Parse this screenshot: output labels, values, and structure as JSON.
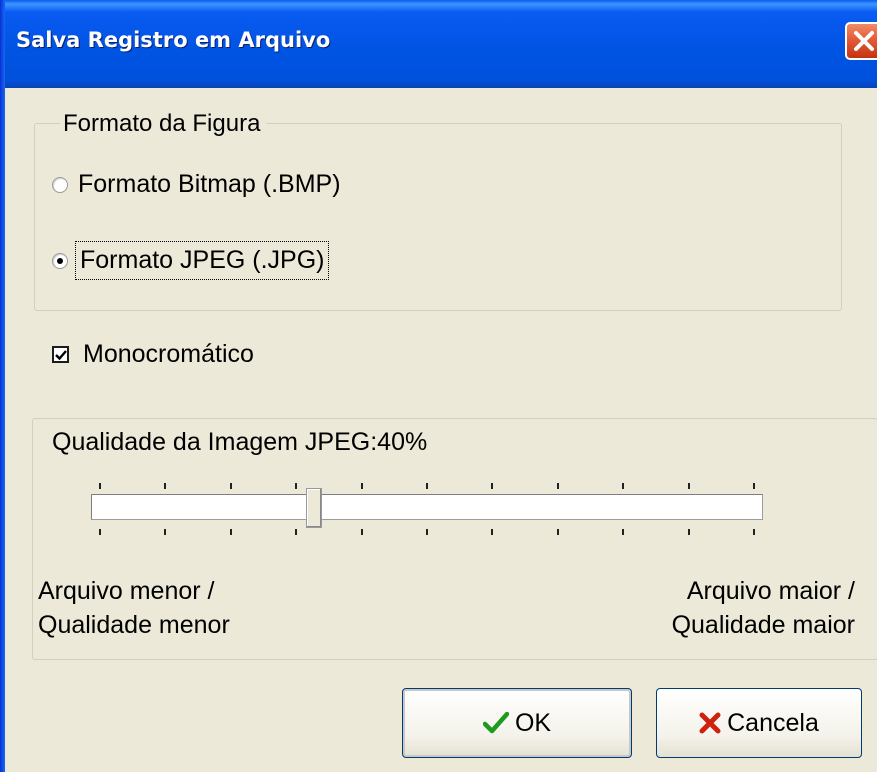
{
  "window": {
    "title": "Salva Registro em Arquivo"
  },
  "format_group": {
    "legend": "Formato da Figura",
    "options": [
      {
        "label": "Formato Bitmap (.BMP)",
        "checked": false
      },
      {
        "label": "Formato JPEG (.JPG)",
        "checked": true,
        "focused": true
      }
    ]
  },
  "monochrome": {
    "label": "Monocromático",
    "checked": true
  },
  "quality": {
    "label": "Qualidade da Imagem JPEG:",
    "value_text": "40%",
    "slider_value": 30,
    "slider_min": 0,
    "slider_max": 100,
    "tick_count": 10,
    "left_label": [
      "Arquivo menor /",
      "Qualidade menor"
    ],
    "right_label": [
      "Arquivo maior /",
      "Qualidade maior"
    ]
  },
  "buttons": {
    "ok": {
      "label": "OK",
      "icon": "checkmark-icon",
      "color": "#1E9A1E"
    },
    "cancel": {
      "label": "Cancela",
      "icon": "x-mark-icon",
      "color": "#D0200E"
    }
  }
}
